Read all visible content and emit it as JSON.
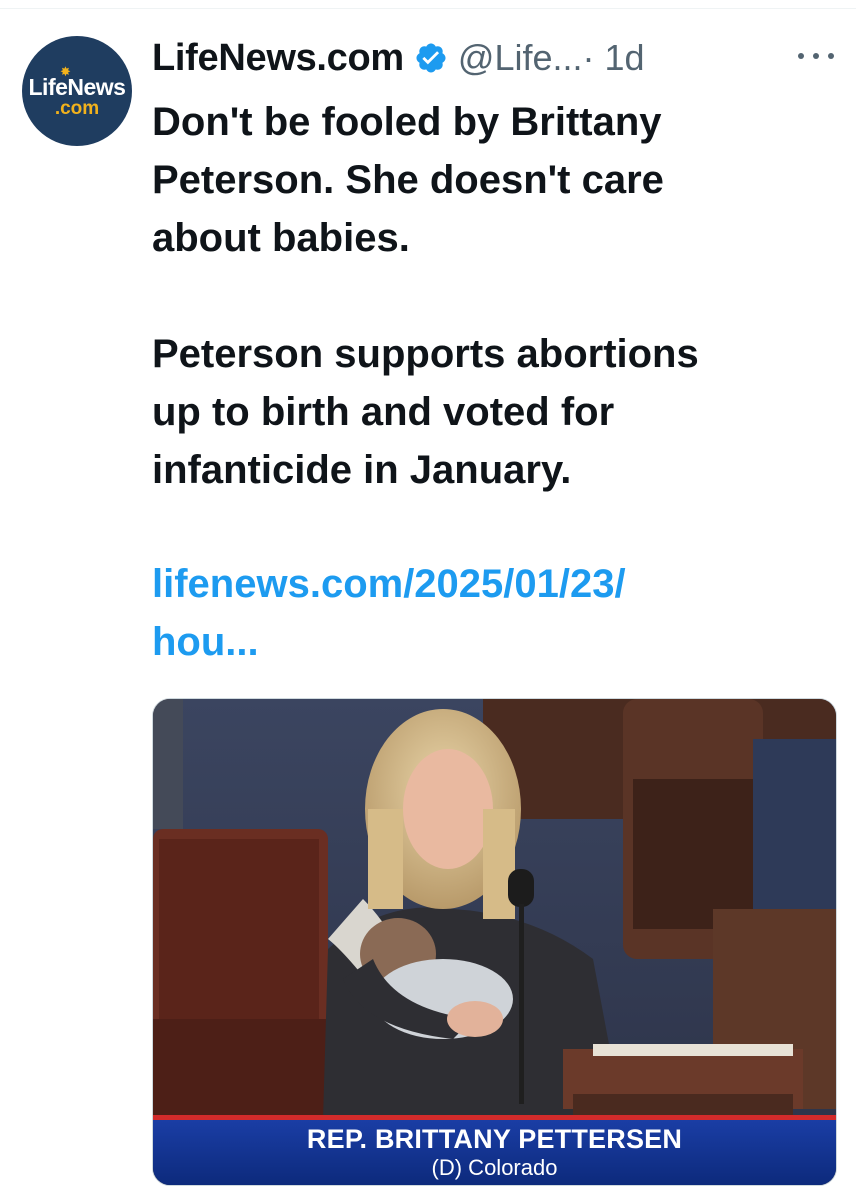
{
  "author": {
    "avatar_logo_main": "LifeNews",
    "avatar_logo_sub": ".com",
    "display_name": "LifeNews.com",
    "handle": "@Life...",
    "time": "· 1d",
    "verified": true
  },
  "tweet": {
    "text": "Don't be fooled by Brittany\nPeterson. She doesn't care\nabout babies.\n\nPeterson supports abortions\nup to birth and voted for\ninfanticide in January.",
    "link": "lifenews.com/2025/01/23/\nhou..."
  },
  "media": {
    "chyron_name": "REP. BRITTANY PETTERSEN",
    "chyron_sub": "(D) Colorado"
  },
  "icons": {
    "verified": "verified-badge-icon",
    "more": "more-options-icon"
  },
  "colors": {
    "link": "#1d9bf0",
    "verified": "#1d9bf0",
    "secondary_text": "#536471",
    "chyron_blue": "#1b3fa8"
  }
}
